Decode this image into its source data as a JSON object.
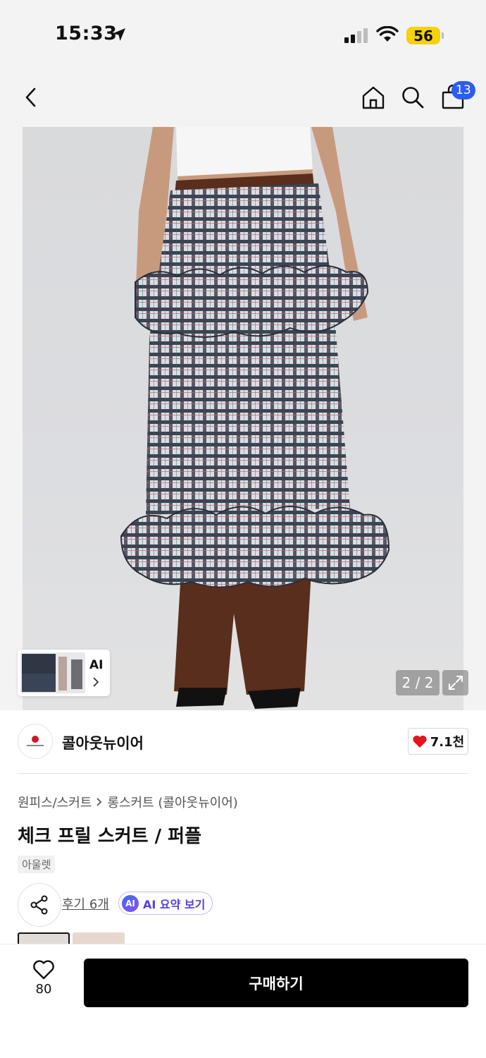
{
  "status_bar": {
    "time": "15:33",
    "battery": "56",
    "icons": [
      "location-arrow-icon",
      "cellular-signal-icon",
      "wifi-icon",
      "battery-icon"
    ]
  },
  "header": {
    "icons": [
      "back-chevron-icon",
      "home-icon",
      "search-icon",
      "shopping-bag-icon"
    ],
    "cart_badge": "13"
  },
  "gallery": {
    "ai_thumb_label": "AI",
    "counter": "2 / 2",
    "colors": {
      "plaid_dark": "#3d4350",
      "plaid_light": "#e4e4ea",
      "plaid_red": "#c2666f",
      "trouser_brown": "#5a2e1c"
    }
  },
  "brand": {
    "name": "콜아웃뉴이어",
    "likes": "7.1천",
    "colors": {
      "heart": "#e5141d"
    }
  },
  "product": {
    "breadcrumb": [
      "원피스/스커트",
      "롱스커트 (콜아웃뉴이어)"
    ],
    "title": "체크 프릴 스커트 / 퍼플",
    "tag": "아울렛",
    "review_link": "후기 6개",
    "ai_summary_icon_text": "AI",
    "ai_summary_label": "AI 요약 보기"
  },
  "bottom_bar": {
    "wish_count": "80",
    "buy_label": "구매하기"
  },
  "accent": {
    "badge": "#2d5cf0",
    "buy_button": "#000000",
    "battery": "#f5d20a"
  }
}
